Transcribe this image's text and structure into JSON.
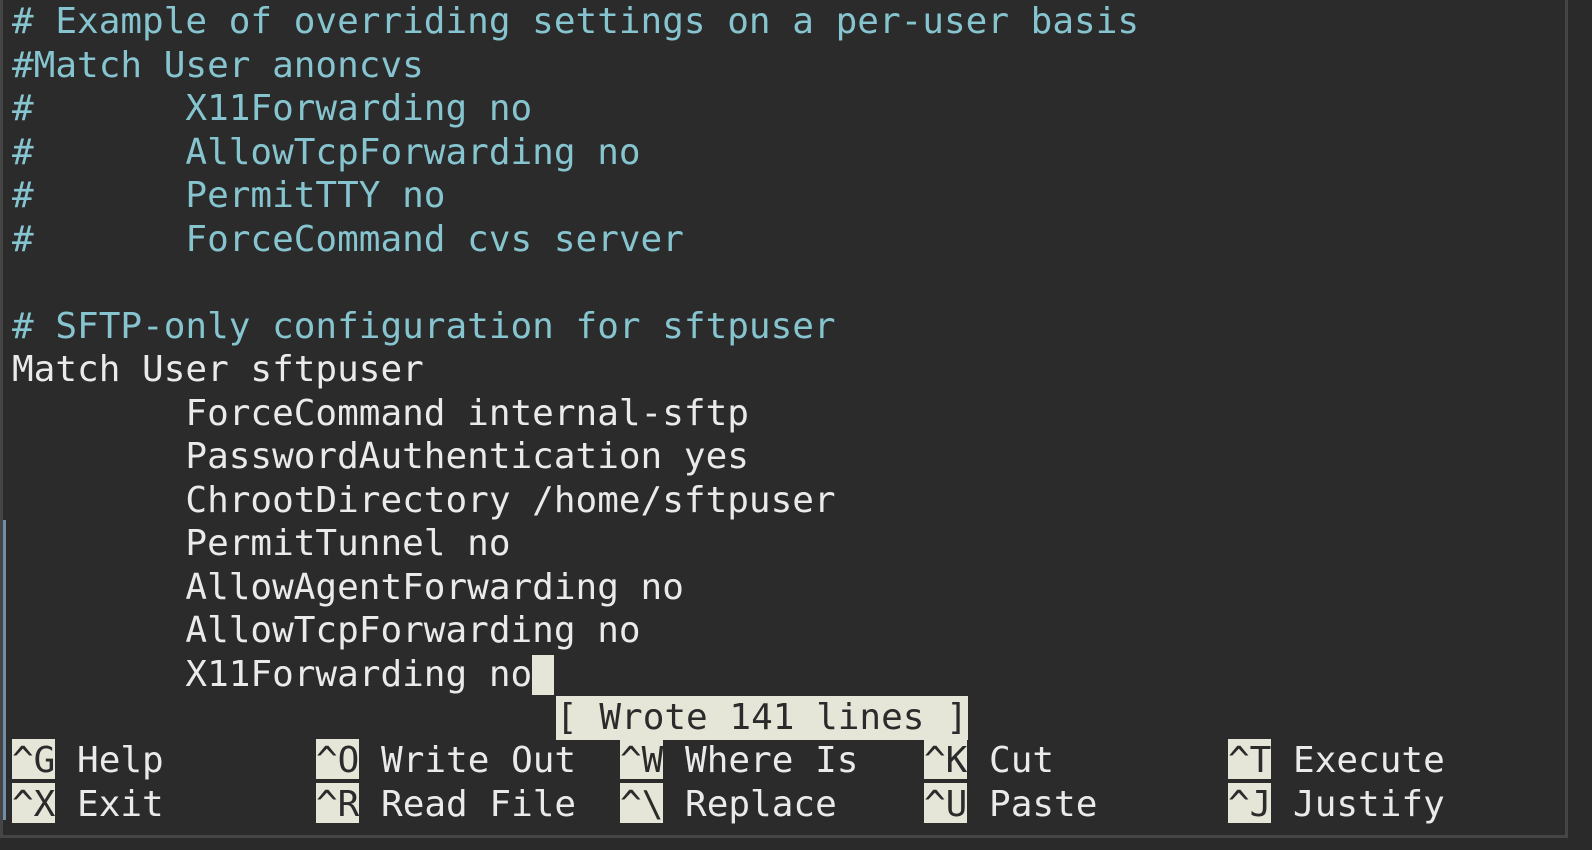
{
  "editor": {
    "lines": [
      {
        "text": "# Example of overriding settings on a per-user basis",
        "kind": "comment"
      },
      {
        "text": "#Match User anoncvs",
        "kind": "comment"
      },
      {
        "text": "#       X11Forwarding no",
        "kind": "comment"
      },
      {
        "text": "#       AllowTcpForwarding no",
        "kind": "comment"
      },
      {
        "text": "#       PermitTTY no",
        "kind": "comment"
      },
      {
        "text": "#       ForceCommand cvs server",
        "kind": "comment"
      },
      {
        "text": "",
        "kind": "normal"
      },
      {
        "text": "# SFTP-only configuration for sftpuser",
        "kind": "comment"
      },
      {
        "text": "Match User sftpuser",
        "kind": "normal"
      },
      {
        "text": "        ForceCommand internal-sftp",
        "kind": "normal"
      },
      {
        "text": "        PasswordAuthentication yes",
        "kind": "normal"
      },
      {
        "text": "        ChrootDirectory /home/sftpuser",
        "kind": "normal"
      },
      {
        "text": "        PermitTunnel no",
        "kind": "normal"
      },
      {
        "text": "        AllowAgentForwarding no",
        "kind": "normal"
      },
      {
        "text": "        AllowTcpForwarding no",
        "kind": "normal"
      },
      {
        "text": "        X11Forwarding no",
        "kind": "normal"
      }
    ]
  },
  "status": {
    "message": "[ Wrote 141 lines ]"
  },
  "shortcuts": {
    "row1": [
      {
        "key": "^G",
        "label": " Help"
      },
      {
        "key": "^O",
        "label": " Write Out"
      },
      {
        "key": "^W",
        "label": " Where Is"
      },
      {
        "key": "^K",
        "label": " Cut"
      },
      {
        "key": "^T",
        "label": " Execute"
      }
    ],
    "row2": [
      {
        "key": "^X",
        "label": " Exit"
      },
      {
        "key": "^R",
        "label": " Read File"
      },
      {
        "key": "^\\",
        "label": " Replace"
      },
      {
        "key": "^U",
        "label": " Paste"
      },
      {
        "key": "^J",
        "label": " Justify"
      }
    ]
  },
  "colors": {
    "background": "#2b2b2b",
    "comment": "#86c5cf",
    "text": "#eaeaea",
    "highlight": "#e6e6d8"
  }
}
